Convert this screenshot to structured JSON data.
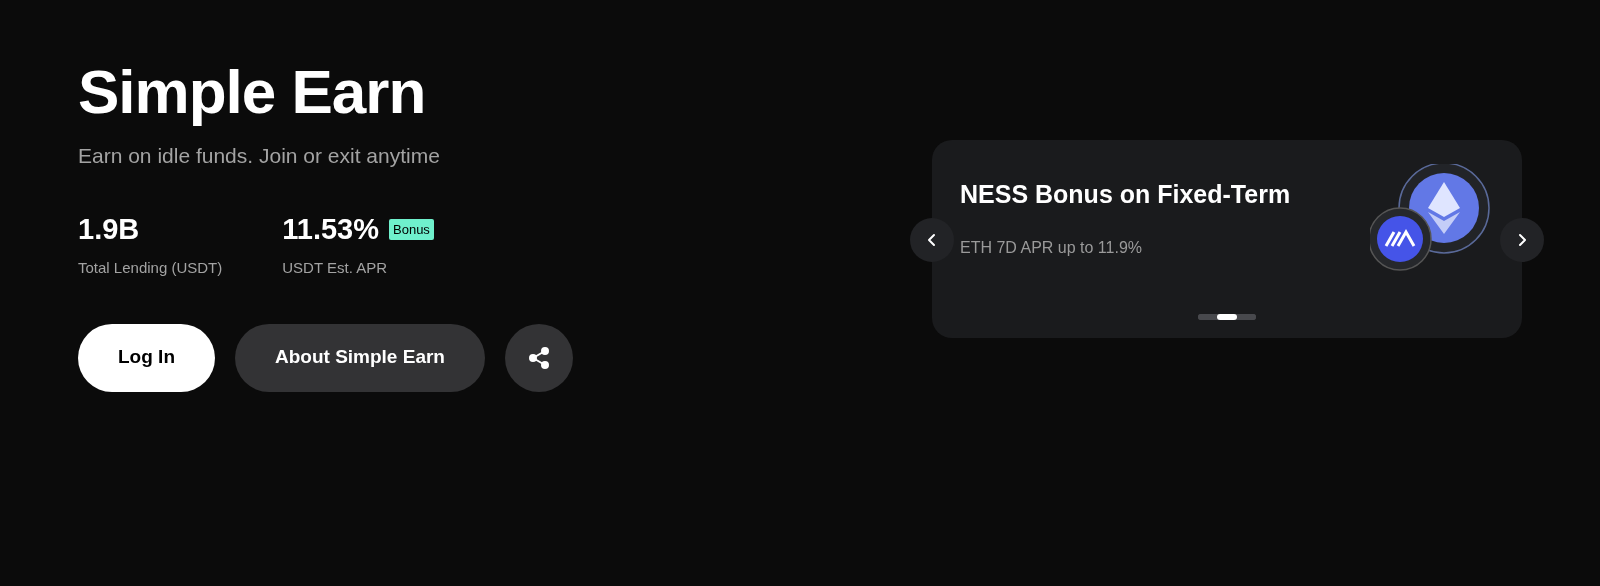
{
  "hero": {
    "title": "Simple Earn",
    "subtitle": "Earn on idle funds. Join or exit anytime"
  },
  "stats": [
    {
      "value": "1.9B",
      "label": "Total Lending (USDT)"
    },
    {
      "value": "11.53%",
      "label": "USDT Est. APR",
      "badge": "Bonus"
    }
  ],
  "buttons": [
    {
      "label": "Log In",
      "kind": "primary"
    },
    {
      "label": "About Simple Earn",
      "kind": "secondary"
    },
    {
      "kind": "share"
    }
  ],
  "carousel": {
    "title": "NESS Bonus on Fixed-Term",
    "subtitle": "ETH 7D APR up to 11.9%",
    "dots": [
      {
        "selected": false
      },
      {
        "selected": true
      },
      {
        "selected": false
      }
    ]
  }
}
